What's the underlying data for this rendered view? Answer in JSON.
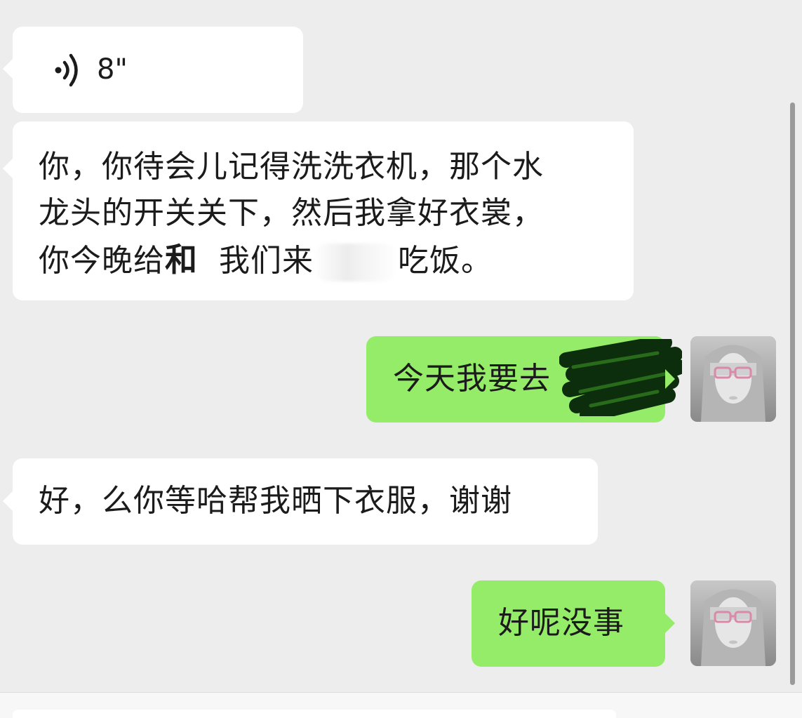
{
  "messages": [
    {
      "id": "voice",
      "side": "left",
      "type": "voice",
      "duration": "8\""
    },
    {
      "id": "msg2",
      "side": "left",
      "type": "text",
      "lines": [
        "你，你待会儿记得洗洗衣机，那个水",
        "龙头的开关关下，然后我拿好衣裳，"
      ],
      "line3_a": "你今晚给",
      "line3_bold": "和",
      "line3_b": "我们来",
      "line3_c": "吃饭。"
    },
    {
      "id": "msg3",
      "side": "right",
      "type": "text",
      "text": "今天我要去"
    },
    {
      "id": "msg4",
      "side": "left",
      "type": "text",
      "text": "好，么你等哈帮我晒下衣服，谢谢"
    },
    {
      "id": "msg5",
      "side": "right",
      "type": "text",
      "text": "好呢没事"
    }
  ],
  "colors": {
    "background": "#ededed",
    "left_bubble": "#ffffff",
    "right_bubble": "#95ec69"
  },
  "icons": {
    "voice": "voice-wave-icon",
    "avatar": "user-avatar"
  }
}
